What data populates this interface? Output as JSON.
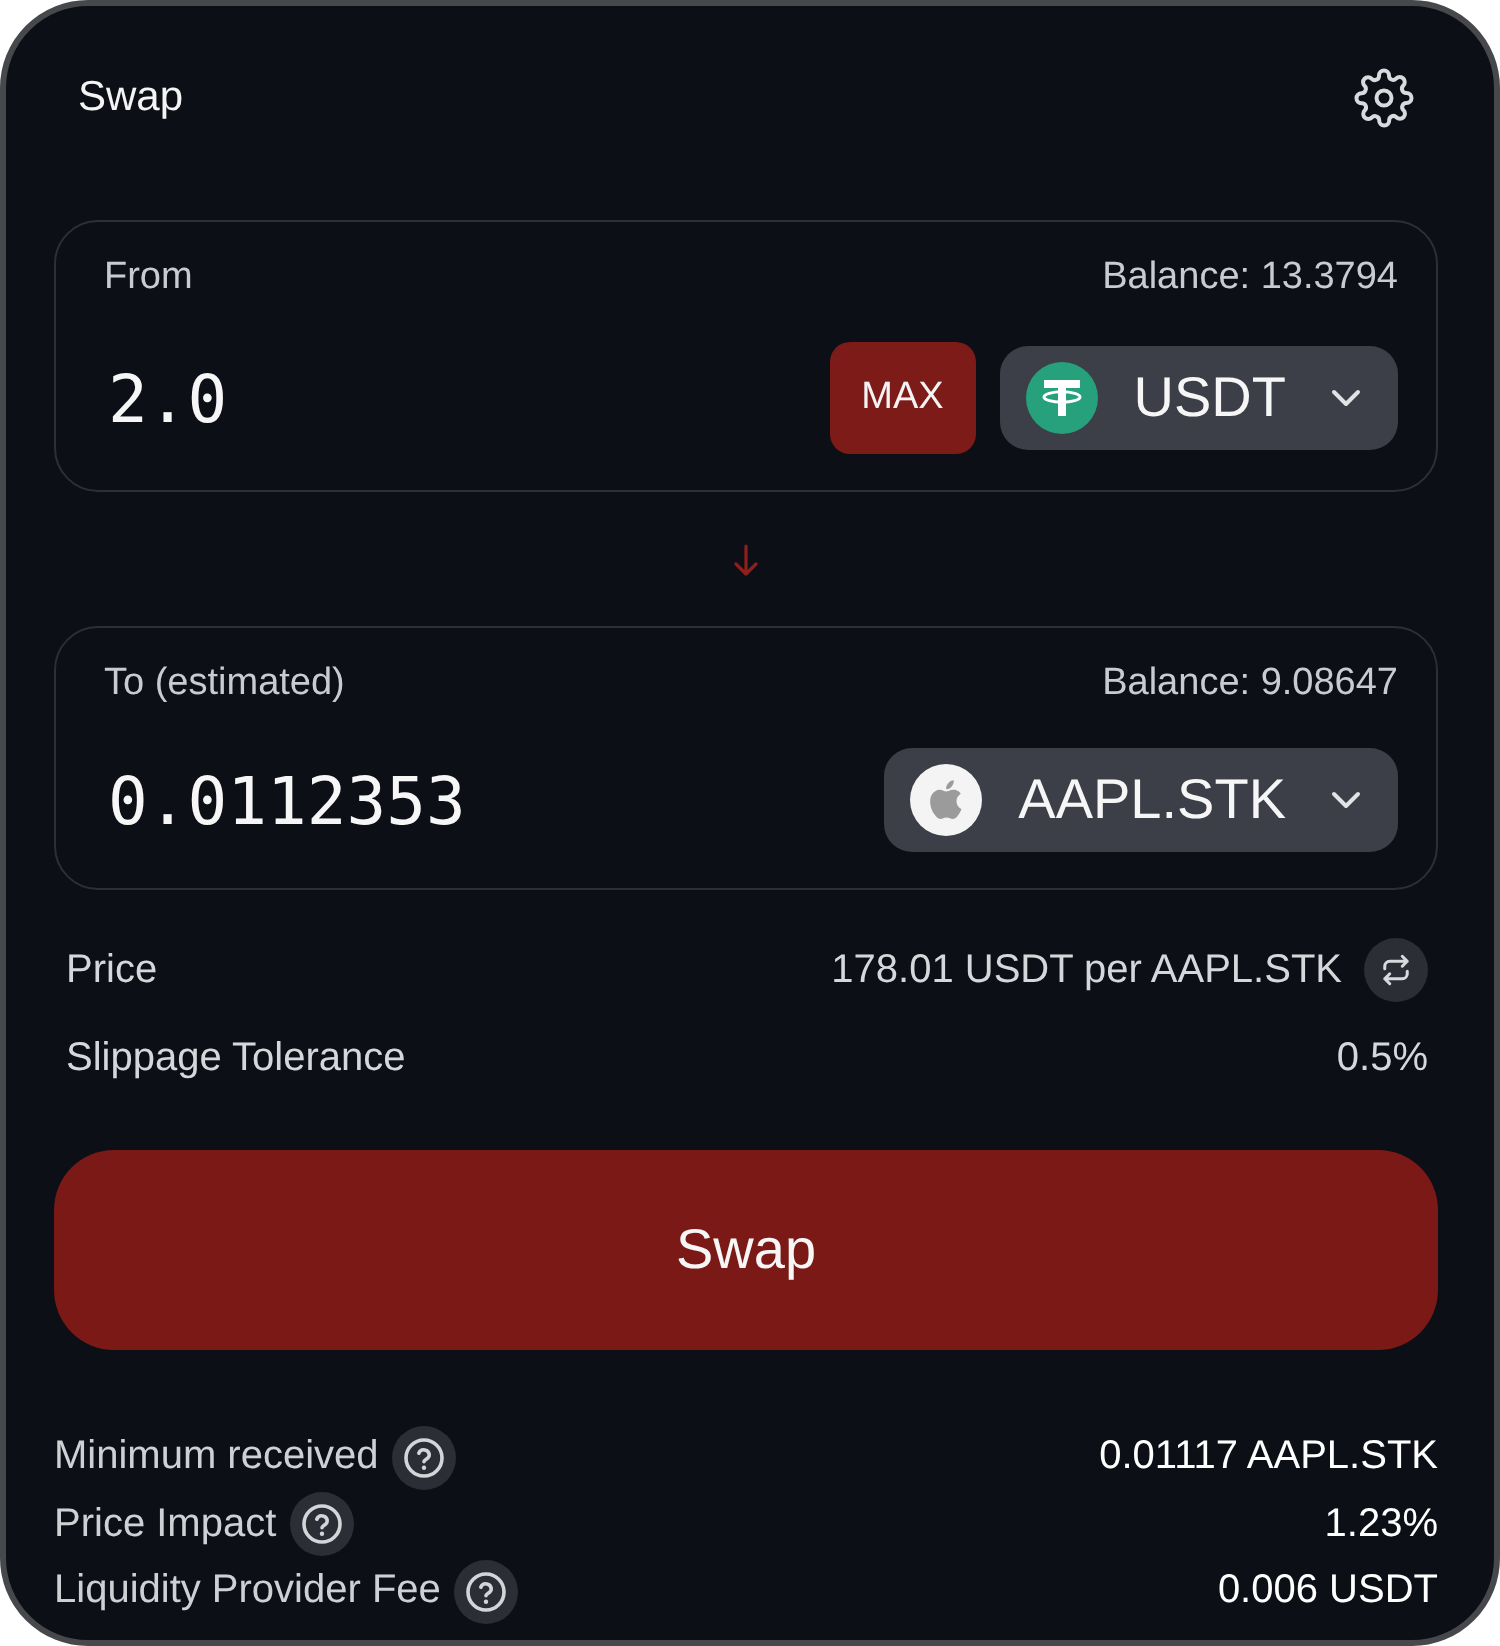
{
  "header": {
    "title": "Swap"
  },
  "panels": [
    {
      "label": "From",
      "balance": "Balance: 13.3794",
      "amount": "2.0",
      "max_button": "MAX",
      "token": {
        "symbol": "USDT",
        "kind": "tether"
      }
    },
    {
      "label": "To (estimated)",
      "balance": "Balance: 9.08647",
      "amount": "0.0112353",
      "token": {
        "symbol": "AAPL.STK",
        "kind": "apple"
      }
    }
  ],
  "rates": [
    {
      "label": "Price",
      "value": "178.01 USDT per AAPL.STK",
      "kind": "toggle"
    },
    {
      "label": "Slippage Tolerance",
      "value": "0.5%",
      "kind": "plain"
    }
  ],
  "swap_button": "Swap",
  "details": [
    {
      "label": "Minimum received",
      "value": "0.01117 AAPL.STK"
    },
    {
      "label": "Price Impact",
      "value": "1.23%"
    },
    {
      "label": "Liquidity Provider Fee",
      "value": "0.006 USDT"
    }
  ]
}
